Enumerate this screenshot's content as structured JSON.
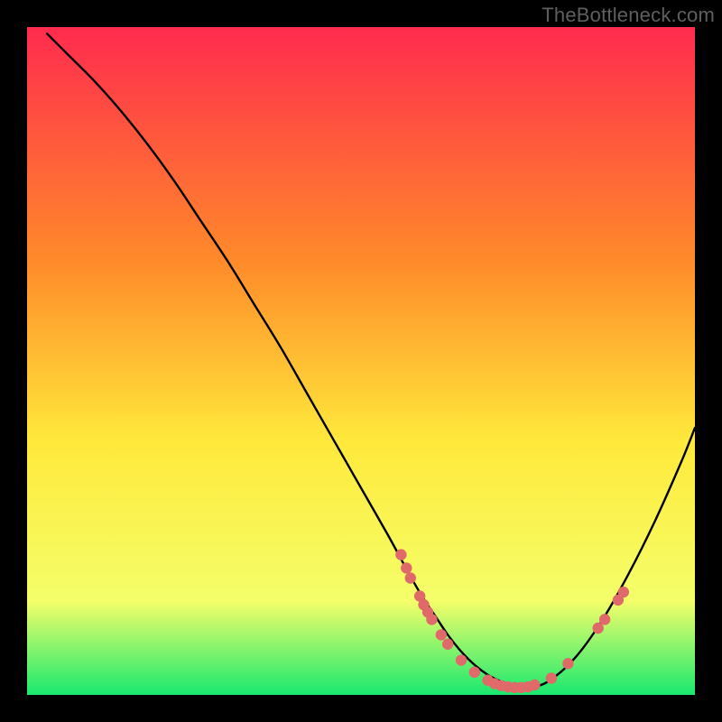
{
  "watermark": "TheBottleneck.com",
  "chart_data": {
    "type": "line",
    "title": "",
    "xlabel": "",
    "ylabel": "",
    "xlim": [
      0,
      100
    ],
    "ylim": [
      0,
      100
    ],
    "background_gradient": {
      "top": "#ff2b4e",
      "mid1": "#ff8a2a",
      "mid2": "#ffe93b",
      "mid3": "#f4ff6a",
      "bottom": "#19e86f"
    },
    "series": [
      {
        "name": "bottleneck-curve",
        "x": [
          3,
          6,
          10,
          14,
          18,
          22,
          26,
          30,
          34,
          38,
          42,
          46,
          50,
          54,
          57,
          59,
          61,
          63,
          65,
          67,
          69,
          71,
          73,
          75,
          78,
          82,
          86,
          90,
          94,
          98,
          100
        ],
        "y": [
          99,
          96,
          92,
          87.5,
          82.5,
          77,
          71,
          65,
          58.5,
          52,
          45,
          38,
          31,
          24,
          18.5,
          15,
          12,
          9,
          6.5,
          4.5,
          3,
          2,
          1.3,
          1.1,
          2,
          5.5,
          11,
          18,
          26,
          35,
          40
        ],
        "color": "#000000",
        "width": 2.4
      }
    ],
    "marker_clusters": [
      {
        "name": "descending-markers",
        "color": "#e06a6a",
        "points": [
          {
            "x": 56.0,
            "y": 21.0
          },
          {
            "x": 56.8,
            "y": 19.0
          },
          {
            "x": 57.4,
            "y": 17.5
          },
          {
            "x": 58.8,
            "y": 14.8
          },
          {
            "x": 59.4,
            "y": 13.5
          },
          {
            "x": 60.0,
            "y": 12.4
          },
          {
            "x": 60.6,
            "y": 11.3
          },
          {
            "x": 62.0,
            "y": 9.0
          },
          {
            "x": 63.0,
            "y": 7.6
          },
          {
            "x": 65.0,
            "y": 5.2
          },
          {
            "x": 67.0,
            "y": 3.4
          }
        ]
      },
      {
        "name": "valley-markers",
        "color": "#e06a6a",
        "points": [
          {
            "x": 69.0,
            "y": 2.2
          },
          {
            "x": 70.0,
            "y": 1.7
          },
          {
            "x": 71.0,
            "y": 1.4
          },
          {
            "x": 72.0,
            "y": 1.2
          },
          {
            "x": 73.0,
            "y": 1.1
          },
          {
            "x": 74.0,
            "y": 1.1
          },
          {
            "x": 75.0,
            "y": 1.2
          },
          {
            "x": 76.0,
            "y": 1.5
          },
          {
            "x": 78.5,
            "y": 2.5
          }
        ]
      },
      {
        "name": "ascending-markers",
        "color": "#e06a6a",
        "points": [
          {
            "x": 81.0,
            "y": 4.7
          },
          {
            "x": 85.5,
            "y": 10.0
          },
          {
            "x": 86.5,
            "y": 11.3
          },
          {
            "x": 88.5,
            "y": 14.2
          },
          {
            "x": 89.3,
            "y": 15.4
          }
        ]
      }
    ]
  }
}
